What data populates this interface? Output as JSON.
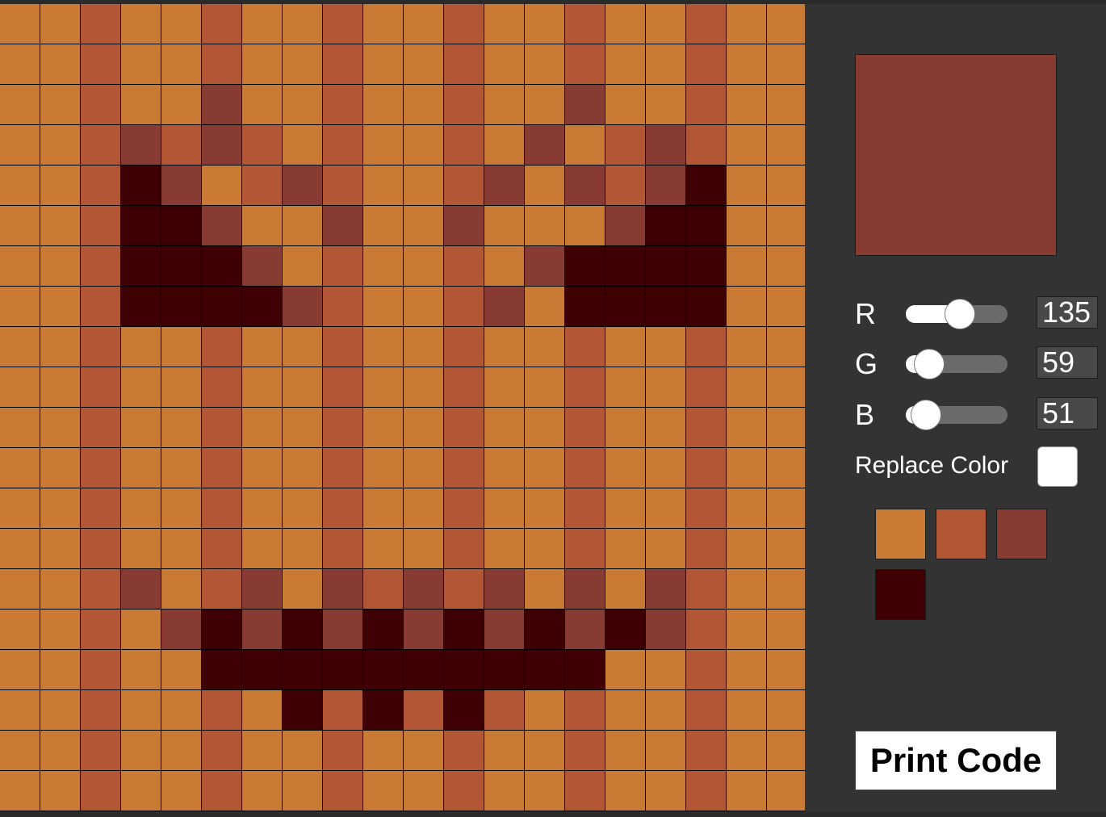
{
  "palette_colors": {
    "c0": "#c97b35",
    "c1": "#b35636",
    "c2": "#873b33",
    "c3": "#3e0003"
  },
  "grid_rows": [
    "00100100100100100100",
    "00100100100100100100",
    "00100200100100200100",
    "00121210100102012100",
    "00132012100120212300",
    "00133200200200023300",
    "00133320100102333300",
    "00133332100120333300",
    "00100100100100100100",
    "00100100100100100100",
    "00100100100100100100",
    "00100100100100100100",
    "00100100100100100100",
    "00100100100100100100",
    "00120120212120202100",
    "00102323232323232100",
    "00100333333333300100",
    "00100103131310100100",
    "00100100100100100100",
    "00100100100100100100"
  ],
  "panel": {
    "preview_color": "#873b33",
    "sliders": [
      {
        "label": "R",
        "value": "135",
        "fraction": 0.53
      },
      {
        "label": "G",
        "value": "59",
        "fraction": 0.23
      },
      {
        "label": "B",
        "value": "51",
        "fraction": 0.2
      }
    ],
    "replace_label": "Replace Color",
    "replace_color": "#ffffff",
    "swatches": [
      "#c97b35",
      "#b35636",
      "#873b33",
      "#3e0003"
    ],
    "print_label": "Print Code"
  }
}
